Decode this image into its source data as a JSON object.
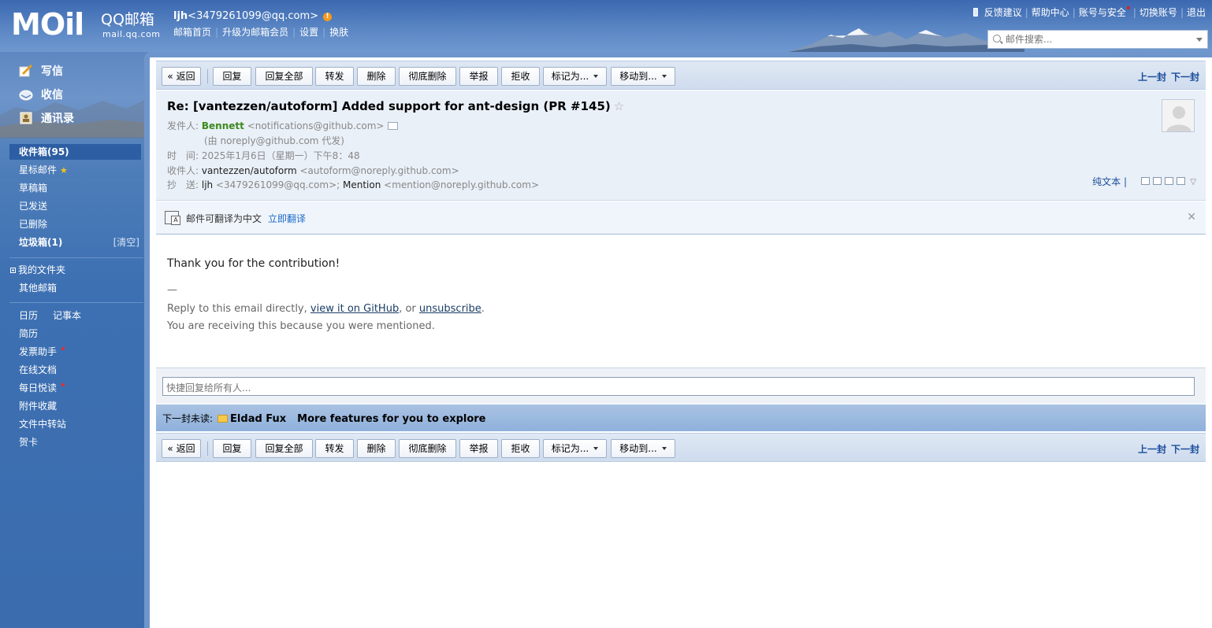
{
  "header": {
    "logo_main": "MOil",
    "logo_qq": "QQ邮箱",
    "logo_domain": "mail.qq.com",
    "user_name": "ljh",
    "user_email": "<3479261099@qq.com>",
    "links": [
      "邮箱首页",
      "升级为邮箱会员",
      "设置",
      "换肤"
    ],
    "top_right": [
      "反馈建议",
      "帮助中心",
      "账号与安全",
      "切换账号",
      "退出"
    ],
    "search_placeholder": "邮件搜索..."
  },
  "sidebar": {
    "primary": [
      {
        "label": "写信",
        "icon": "pencil-icon"
      },
      {
        "label": "收信",
        "icon": "inbox-icon"
      },
      {
        "label": "通讯录",
        "icon": "contacts-icon"
      }
    ],
    "folders": {
      "inbox": "收件箱(95)",
      "starred": "星标邮件",
      "drafts": "草稿箱",
      "sent": "已发送",
      "deleted": "已删除",
      "spam": "垃圾箱(1)",
      "spam_clear": "[清空]"
    },
    "my_folders": "我的文件夹",
    "other_mail": "其他邮箱",
    "tools": {
      "calendar": "日历",
      "notes": "记事本",
      "resume": "简历",
      "invoice": "发票助手",
      "docs": "在线文档",
      "daily": "每日悦读",
      "attachments": "附件收藏",
      "transfer": "文件中转站",
      "cards": "贺卡"
    }
  },
  "toolbar": {
    "back": "« 返回",
    "reply": "回复",
    "reply_all": "回复全部",
    "forward": "转发",
    "delete": "删除",
    "delete_permanent": "彻底删除",
    "report": "举报",
    "reject": "拒收",
    "mark_as": "标记为...",
    "move_to": "移动到...",
    "prev": "上一封",
    "next": "下一封"
  },
  "mail": {
    "subject": "Re: [vantezzen/autoform] Added support for ant-design (PR #145)",
    "star": "☆",
    "from_label": "发件人:",
    "from_name": "Bennett",
    "from_email": "<notifications@github.com>",
    "on_behalf": "(由 noreply@github.com 代发)",
    "time_label": "时　间:",
    "time": "2025年1月6日（星期一）下午8：48",
    "to_label": "收件人:",
    "to_name": "vantezzen/autoform",
    "to_email": "<autoform@noreply.github.com>",
    "cc_label": "抄　送:",
    "cc_1_name": "ljh",
    "cc_1_email": "<3479261099@qq.com>;",
    "cc_2_name": "Mention",
    "cc_2_email": "<mention@noreply.github.com>",
    "plain_text": "纯文本 |",
    "translate_text": "邮件可翻译为中文",
    "translate_link": "立即翻译",
    "body_main": "Thank you for the contribution!",
    "body_dash": "—",
    "reply_prefix": "Reply to this email directly, ",
    "reply_link_1": "view it on GitHub",
    "reply_mid": ", or ",
    "reply_link_2": "unsubscribe",
    "reply_suffix": ".",
    "body_why": "You are receiving this because you were mentioned.",
    "quick_reply_placeholder": "快捷回复给所有人...",
    "next_unread_label": "下一封未读:",
    "next_unread_from": "Eldad Fux",
    "next_unread_subject": "More features for you to explore"
  }
}
